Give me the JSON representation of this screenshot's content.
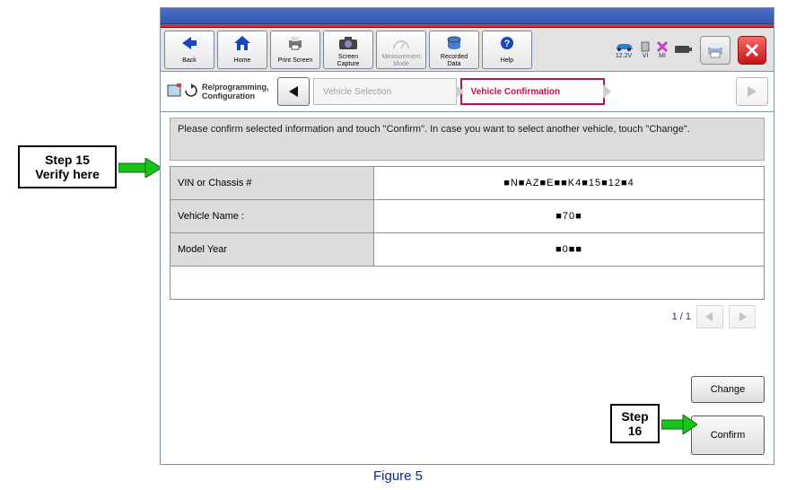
{
  "toolbar": {
    "back": "Back",
    "home": "Home",
    "print_screen": "Print Screen",
    "screen_capture": "Screen\nCapture",
    "measurement_mode": "Measurement\nMode",
    "recorded_data": "Recorded\nData",
    "help": "Help"
  },
  "indicators": {
    "voltage": "12.2V",
    "vi": "VI",
    "mi": "MI"
  },
  "mode": {
    "label": "Re/programming,\nConfiguration"
  },
  "crumbs": {
    "prev": "Vehicle Selection",
    "current": "Vehicle Confirmation"
  },
  "instruction": "Please confirm selected information and touch \"Confirm\". In case you want to select another vehicle, touch \"Change\".",
  "table": {
    "row1_key": "VIN or Chassis #",
    "row1_val": "■N■AZ■E■■K4■15■12■4",
    "row2_key": "Vehicle Name :",
    "row2_val": "■70■",
    "row3_key": "Model Year",
    "row3_val": "■0■■"
  },
  "pager": {
    "text": "1 / 1"
  },
  "actions": {
    "change": "Change",
    "confirm": "Confirm"
  },
  "callouts": {
    "step15": "Step 15\nVerify here",
    "step16": "Step\n16"
  },
  "figure": "Figure 5"
}
